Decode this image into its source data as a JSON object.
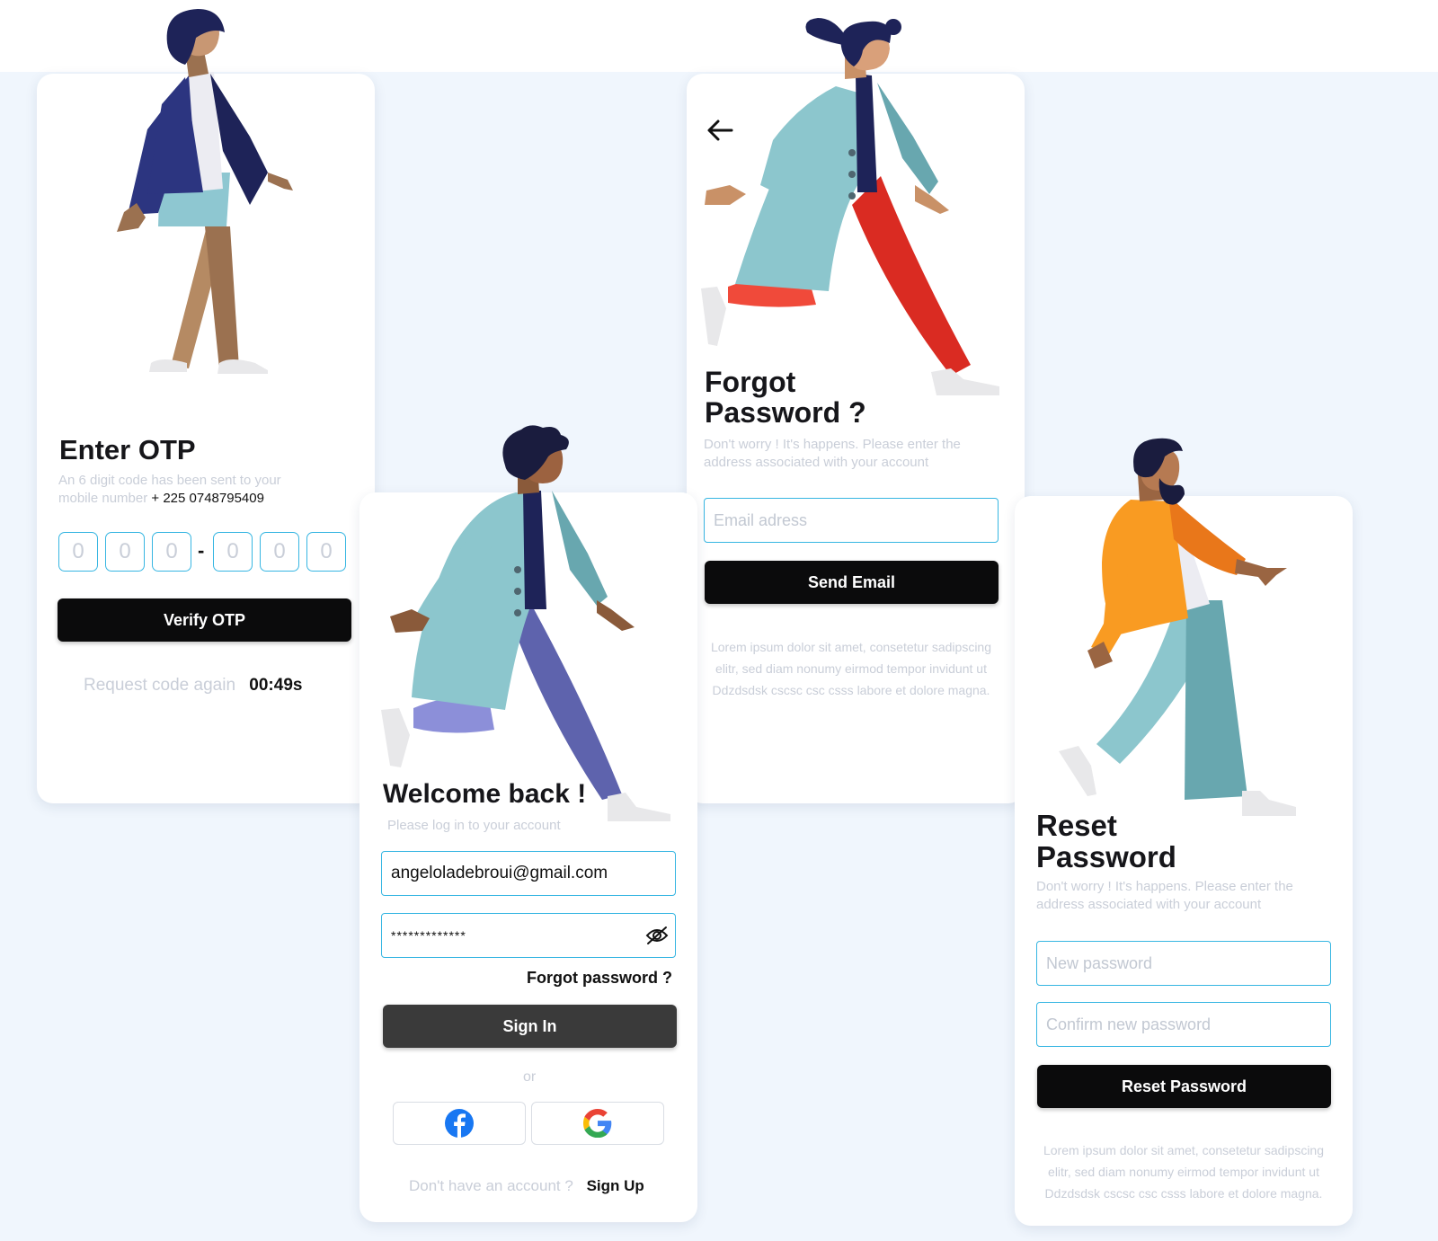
{
  "otp": {
    "title": "Enter OTP",
    "subtitle_prefix": "An 6 digit code has been sent to your mobile number",
    "phone": "+ 225 0748795409",
    "digits": [
      "0",
      "0",
      "0",
      "0",
      "0",
      "0"
    ],
    "separator": "-",
    "verify_label": "Verify OTP",
    "request_label": "Request code again",
    "timer": "00:49s"
  },
  "login": {
    "title": "Welcome back !",
    "subtitle": "Please log in to your account",
    "email_value": "angeloladebroui@gmail.com",
    "password_mask": "*************",
    "forgot_label": "Forgot password ?",
    "signin_label": "Sign In",
    "or_label": "or",
    "no_account_label": "Don't have an account ?",
    "signup_label": "Sign Up",
    "icons": [
      "facebook-icon",
      "google-icon",
      "eye-off-icon"
    ]
  },
  "forgot": {
    "title_line1": "Forgot",
    "title_line2": "Password ?",
    "subtitle": "Don't worry ! It's happens. Please enter the address associated with your account",
    "email_placeholder": "Email adress",
    "send_label": "Send Email",
    "lorem": "Lorem ipsum dolor sit amet, consetetur sadipscing elitr, sed diam nonumy eirmod tempor invidunt ut Ddzdsdsk cscsc csc csss  labore et dolore magna."
  },
  "reset": {
    "title_line1": "Reset",
    "title_line2": "Password",
    "subtitle": "Don't worry ! It's happens. Please enter the address associated with your account",
    "new_placeholder": "New password",
    "confirm_placeholder": "Confirm new password",
    "reset_label": "Reset Password",
    "lorem": "Lorem ipsum dolor sit amet, consetetur sadipscing elitr, sed diam nonumy eirmod tempor invidunt ut Ddzdsdsk cscsc csc csss  labore et dolore magna."
  },
  "colors": {
    "accent_border": "#37b6e2",
    "button_dark": "#0b0b0c",
    "signin_button": "#3a3a3a",
    "muted_text": "#c9ced8",
    "page_background": "#f0f6fd"
  }
}
